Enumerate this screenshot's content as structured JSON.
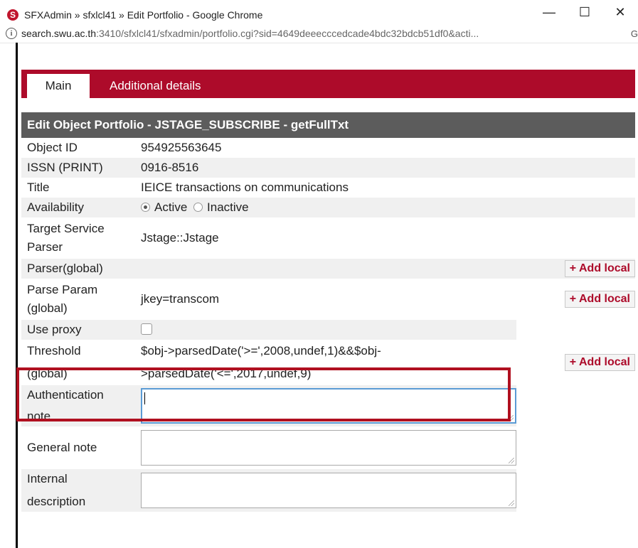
{
  "window": {
    "title": "SFXAdmin » sfxlcl41 » Edit Portfolio - Google Chrome",
    "controls": {
      "minimize": "—",
      "maximize": "☐",
      "close": "✕"
    }
  },
  "addressbar": {
    "host": "search.swu.ac.th",
    "rest": ":3410/sfxlcl41/sfxadmin/portfolio.cgi?sid=4649deeecccedcade4bdc32bdcb51df0&acti...",
    "right_icon": "G"
  },
  "tabs": {
    "main": "Main",
    "additional": "Additional details"
  },
  "section": {
    "header": "Edit Object Portfolio - JSTAGE_SUBSCRIBE - getFullTxt"
  },
  "fields": {
    "object_id": {
      "label": "Object ID",
      "value": "954925563645"
    },
    "issn": {
      "label": "ISSN (PRINT)",
      "value": "0916-8516"
    },
    "title": {
      "label": "Title",
      "value": "IEICE transactions on communications"
    },
    "availability": {
      "label": "Availability",
      "active": "Active",
      "inactive": "Inactive",
      "selected": "Active"
    },
    "target_parser": {
      "label_line1": "Target Service",
      "label_line2": "Parser",
      "value": "Jstage::Jstage"
    },
    "parser_global": {
      "label": "Parser(global)"
    },
    "parse_param": {
      "label_line1": "Parse Param",
      "label_line2": "(global)",
      "value": "jkey=transcom"
    },
    "use_proxy": {
      "label": "Use proxy"
    },
    "threshold": {
      "label_line1": "Threshold",
      "label_line2": "(global)",
      "value_line1": "$obj->parsedDate('>=',2008,undef,1)&&$obj-",
      "value_line2": ">parsedDate('<=',2017,undef,9)"
    },
    "auth_note": {
      "label_line1": "Authentication",
      "label_line2": "note",
      "value": ""
    },
    "general_note": {
      "label": "General note",
      "value": ""
    },
    "internal_desc": {
      "label_line1": "Internal",
      "label_line2": "description",
      "value": ""
    }
  },
  "buttons": {
    "add_local": "+ Add local"
  },
  "colors": {
    "brand": "#ad0b2a",
    "header": "#5c5c5c",
    "highlight": "#b01020"
  }
}
